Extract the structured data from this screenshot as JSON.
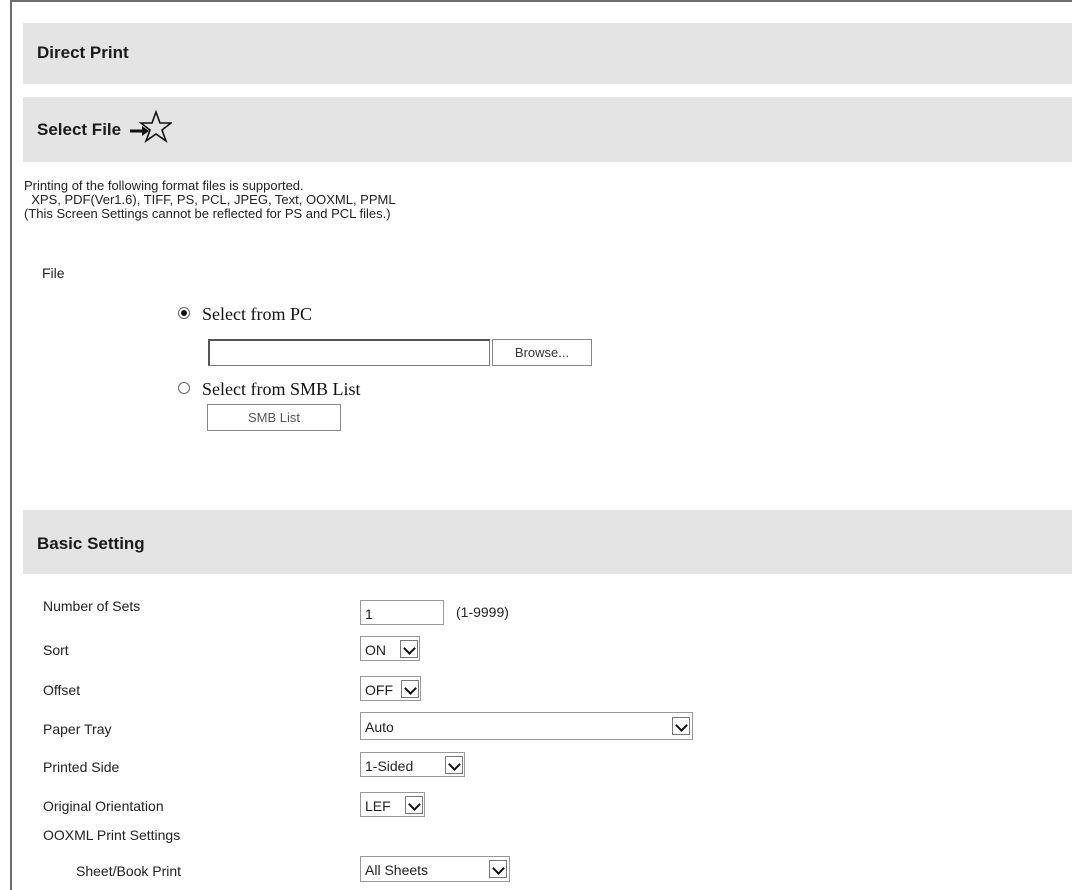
{
  "header": {
    "title": "Direct Print"
  },
  "select_file": {
    "title": "Select File",
    "star_icon": "star-with-arrow-icon",
    "info_lines": [
      "Printing of the following format files is supported.",
      "  XPS, PDF(Ver1.6), TIFF, PS, PCL, JPEG, Text, OOXML, PPML",
      "(This Screen Settings cannot be reflected for PS and PCL files.)"
    ],
    "file_label": "File",
    "option_pc": "Select from PC",
    "browse_label": "Browse...",
    "option_smb": "Select from SMB List",
    "smb_button_label": "SMB List",
    "selected": "Select from PC"
  },
  "basic": {
    "title": "Basic Setting",
    "sets_label": "Number of Sets",
    "sets_value": "1",
    "sets_range": "(1-9999)",
    "sort_label": "Sort",
    "sort_value": "ON",
    "offset_label": "Offset",
    "offset_value": "OFF",
    "tray_label": "Paper Tray",
    "tray_value": "Auto",
    "side_label": "Printed Side",
    "side_value": "1-Sided",
    "orientation_label": "Original Orientation",
    "orientation_value": "LEF",
    "ooxml_label": "OOXML Print Settings",
    "sheet_label": "Sheet/Book Print",
    "sheet_value": "All Sheets"
  }
}
